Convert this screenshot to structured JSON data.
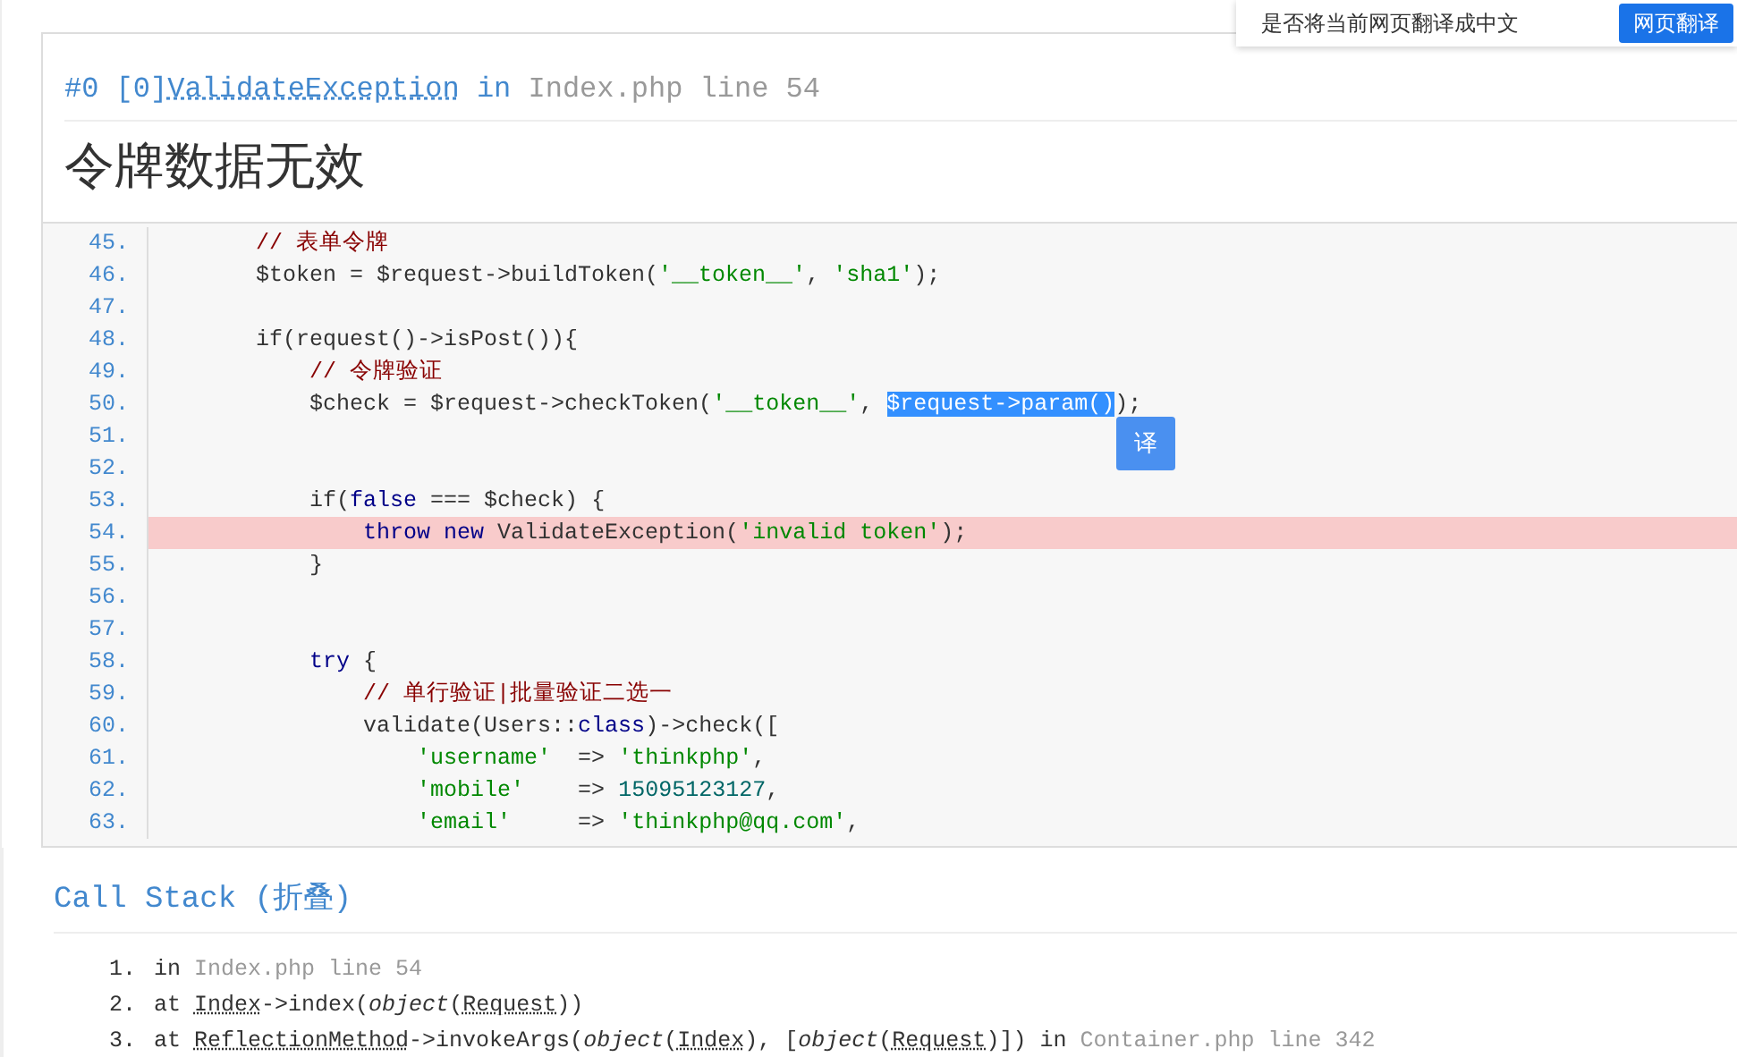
{
  "translate_bar": {
    "message": "是否将当前网页翻译成中文",
    "button": "网页翻译"
  },
  "exception": {
    "segments": [
      {
        "text": "#0 [0]",
        "kind": "plain"
      },
      {
        "text": "ValidateException",
        "kind": "abbr"
      },
      {
        "text": " in ",
        "kind": "plain"
      },
      {
        "text": "Index.php line 54",
        "kind": "file"
      }
    ],
    "message": "令牌数据无效"
  },
  "source": {
    "lines": [
      {
        "no": "45.",
        "highlighted": false,
        "segments": [
          {
            "text": "        // 表单令牌",
            "kind": "comment"
          }
        ]
      },
      {
        "no": "46.",
        "highlighted": false,
        "segments": [
          {
            "text": "        $token = $request->buildToken(",
            "kind": "plain"
          },
          {
            "text": "'__token__'",
            "kind": "string"
          },
          {
            "text": ", ",
            "kind": "plain"
          },
          {
            "text": "'sha1'",
            "kind": "string"
          },
          {
            "text": ");",
            "kind": "plain"
          }
        ]
      },
      {
        "no": "47.",
        "highlighted": false
      },
      {
        "no": "48.",
        "highlighted": false,
        "segments": [
          {
            "text": "        if(request()->isPost()){",
            "kind": "plain"
          }
        ]
      },
      {
        "no": "49.",
        "highlighted": false,
        "segments": [
          {
            "text": "            // 令牌验证",
            "kind": "comment"
          }
        ]
      },
      {
        "no": "50.",
        "highlighted": false,
        "segments": [
          {
            "text": "            $check = $request->checkToken(",
            "kind": "plain"
          },
          {
            "text": "'__token__'",
            "kind": "string"
          },
          {
            "text": ", ",
            "kind": "plain"
          },
          {
            "text": "$request->param()",
            "kind": "selected"
          },
          {
            "text": ");",
            "kind": "plain"
          }
        ]
      },
      {
        "no": "51.",
        "highlighted": false
      },
      {
        "no": "52.",
        "highlighted": false
      },
      {
        "no": "53.",
        "highlighted": false,
        "segments": [
          {
            "text": "            if(",
            "kind": "plain"
          },
          {
            "text": "false",
            "kind": "keyword"
          },
          {
            "text": " === $check) {",
            "kind": "plain"
          }
        ]
      },
      {
        "no": "54.",
        "highlighted": true,
        "segments": [
          {
            "text": "                throw new",
            "kind": "keyword"
          },
          {
            "text": " ValidateException(",
            "kind": "plain"
          },
          {
            "text": "'invalid token'",
            "kind": "string"
          },
          {
            "text": ");",
            "kind": "plain"
          }
        ]
      },
      {
        "no": "55.",
        "highlighted": false,
        "segments": [
          {
            "text": "            }",
            "kind": "plain"
          }
        ]
      },
      {
        "no": "56.",
        "highlighted": false
      },
      {
        "no": "57.",
        "highlighted": false
      },
      {
        "no": "58.",
        "highlighted": false,
        "segments": [
          {
            "text": "            try",
            "kind": "keyword"
          },
          {
            "text": " {",
            "kind": "plain"
          }
        ]
      },
      {
        "no": "59.",
        "highlighted": false,
        "segments": [
          {
            "text": "                // 单行验证|批量验证二选一",
            "kind": "comment"
          }
        ]
      },
      {
        "no": "60.",
        "highlighted": false,
        "segments": [
          {
            "text": "                validate(Users::",
            "kind": "plain"
          },
          {
            "text": "class",
            "kind": "keyword"
          },
          {
            "text": ")->check([",
            "kind": "plain"
          }
        ]
      },
      {
        "no": "61.",
        "highlighted": false,
        "segments": [
          {
            "text": "                    'username'",
            "kind": "string"
          },
          {
            "text": "  => ",
            "kind": "plain"
          },
          {
            "text": "'thinkphp'",
            "kind": "string"
          },
          {
            "text": ",",
            "kind": "plain"
          }
        ]
      },
      {
        "no": "62.",
        "highlighted": false,
        "segments": [
          {
            "text": "                    'mobile'",
            "kind": "string"
          },
          {
            "text": "    => ",
            "kind": "plain"
          },
          {
            "text": "15095123127",
            "kind": "number"
          },
          {
            "text": ",",
            "kind": "plain"
          }
        ]
      },
      {
        "no": "63.",
        "highlighted": false,
        "segments": [
          {
            "text": "                    'email'",
            "kind": "string"
          },
          {
            "text": "     => ",
            "kind": "plain"
          },
          {
            "text": "'thinkphp@qq.com'",
            "kind": "string"
          },
          {
            "text": ",",
            "kind": "plain"
          }
        ]
      }
    ],
    "translate_button": "译"
  },
  "call_stack": {
    "title": "Call Stack (折叠)",
    "items": [
      {
        "no": "1.",
        "segments": [
          {
            "text": "in ",
            "kind": "plain"
          },
          {
            "text": "Index.php line 54",
            "kind": "file"
          }
        ]
      },
      {
        "no": "2.",
        "segments": [
          {
            "text": "at ",
            "kind": "plain"
          },
          {
            "text": "Index",
            "kind": "abbr"
          },
          {
            "text": "->index(",
            "kind": "plain"
          },
          {
            "text": "object",
            "kind": "italic"
          },
          {
            "text": "(",
            "kind": "plain"
          },
          {
            "text": "Request",
            "kind": "abbr"
          },
          {
            "text": "))",
            "kind": "plain"
          }
        ]
      },
      {
        "no": "3.",
        "segments": [
          {
            "text": "at ",
            "kind": "plain"
          },
          {
            "text": "ReflectionMethod",
            "kind": "abbr"
          },
          {
            "text": "->invokeArgs(",
            "kind": "plain"
          },
          {
            "text": "object",
            "kind": "italic"
          },
          {
            "text": "(",
            "kind": "plain"
          },
          {
            "text": "Index",
            "kind": "abbr"
          },
          {
            "text": "), [",
            "kind": "plain"
          },
          {
            "text": "object",
            "kind": "italic"
          },
          {
            "text": "(",
            "kind": "plain"
          },
          {
            "text": "Request",
            "kind": "abbr"
          },
          {
            "text": ")]) in ",
            "kind": "plain"
          },
          {
            "text": "Container.php line 342",
            "kind": "file"
          }
        ]
      }
    ]
  }
}
